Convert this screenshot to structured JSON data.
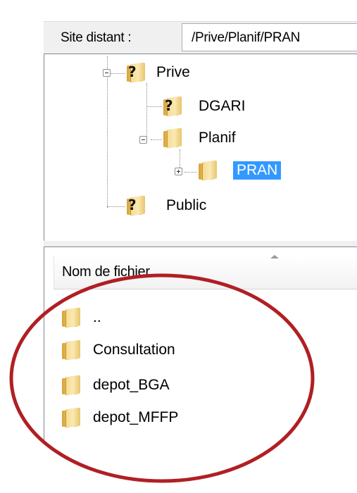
{
  "remote": {
    "label": "Site distant :",
    "path": "/Prive/Planif/PRAN"
  },
  "tree": {
    "items": [
      {
        "label": "Prive",
        "icon": "unknown-folder-icon"
      },
      {
        "label": "DGARI",
        "icon": "unknown-folder-icon"
      },
      {
        "label": "Planif",
        "icon": "folder-icon"
      },
      {
        "label": "PRAN",
        "icon": "folder-icon",
        "selected": true
      },
      {
        "label": "Public",
        "icon": "unknown-folder-icon"
      }
    ]
  },
  "filelist": {
    "column_header": "Nom de fichier",
    "files": [
      {
        "name": ".."
      },
      {
        "name": "Consultation"
      },
      {
        "name": "depot_BGA"
      },
      {
        "name": "depot_MFFP"
      }
    ]
  },
  "colors": {
    "selection": "#3399ff",
    "annotation": "#b01f24"
  }
}
